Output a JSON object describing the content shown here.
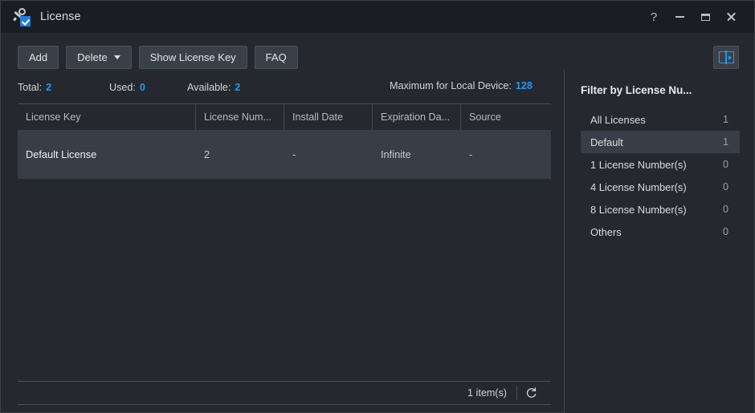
{
  "window": {
    "title": "License",
    "app_icon": "key-check-icon",
    "controls": [
      {
        "name": "help-button",
        "glyph": "?"
      },
      {
        "name": "minimize-button",
        "glyph": "minimize-icon"
      },
      {
        "name": "maximize-button",
        "glyph": "maximize-icon"
      },
      {
        "name": "close-button",
        "glyph": "close-icon"
      }
    ]
  },
  "toolbar": {
    "add_label": "Add",
    "delete_label": "Delete",
    "show_license_key_label": "Show License Key",
    "faq_label": "FAQ",
    "panel_toggle_icon": "split-panel-icon"
  },
  "stats": {
    "total_label": "Total:",
    "total_value": "2",
    "used_label": "Used:",
    "used_value": "0",
    "available_label": "Available:",
    "available_value": "2",
    "maximum_label": "Maximum for Local Device:",
    "maximum_value": "128",
    "accent_color": "#1f9bf0"
  },
  "table": {
    "columns": [
      {
        "label": "License Key"
      },
      {
        "label": "License Num..."
      },
      {
        "label": "Install Date"
      },
      {
        "label": "Expiration Da..."
      },
      {
        "label": "Source"
      }
    ],
    "rows": [
      {
        "license_key": "Default License",
        "license_number": "2",
        "install_date": "-",
        "expiration_date": "Infinite",
        "source": "-",
        "selected": true
      }
    ]
  },
  "footer": {
    "item_count": "1 item(s)",
    "refresh_icon": "refresh-icon"
  },
  "sidebar": {
    "title": "Filter by License Nu...",
    "items": [
      {
        "label": "All Licenses",
        "count": "1",
        "active": false
      },
      {
        "label": "Default",
        "count": "1",
        "active": true
      },
      {
        "label": "1 License Number(s)",
        "count": "0",
        "active": false
      },
      {
        "label": "4 License Number(s)",
        "count": "0",
        "active": false
      },
      {
        "label": "8 License Number(s)",
        "count": "0",
        "active": false
      },
      {
        "label": "Others",
        "count": "0",
        "active": false
      }
    ]
  }
}
